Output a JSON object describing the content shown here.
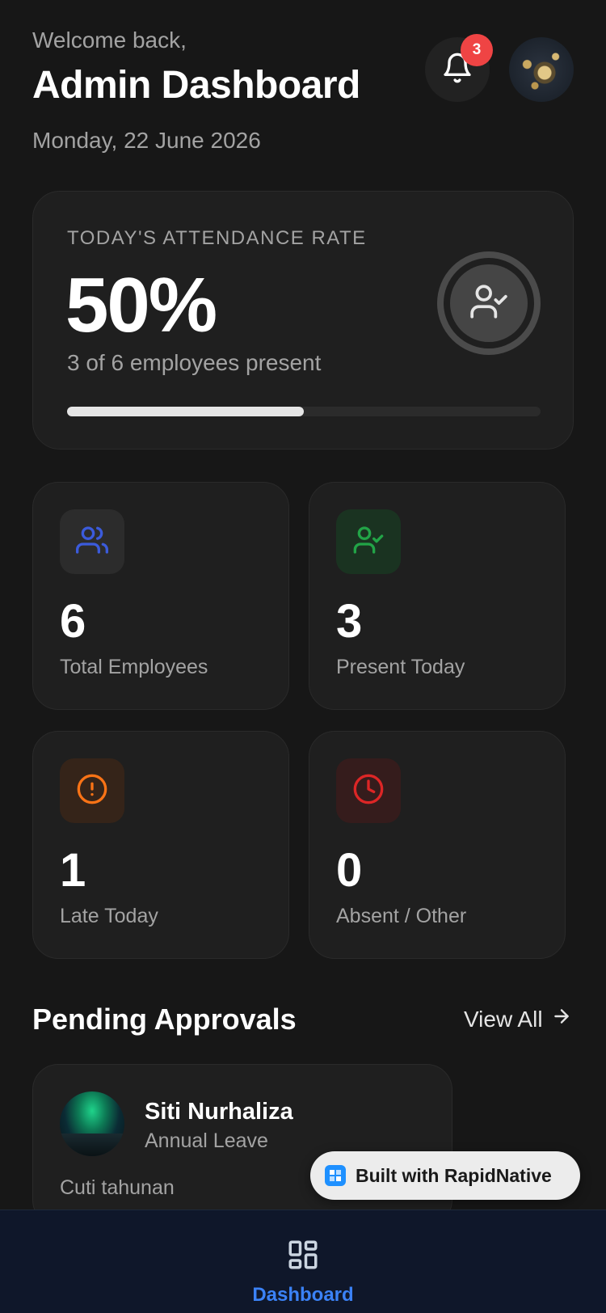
{
  "header": {
    "welcome": "Welcome back,",
    "title": "Admin Dashboard",
    "date": "Monday, 22 June 2026",
    "notification_count": "3"
  },
  "attendance": {
    "label": "TODAY'S ATTENDANCE RATE",
    "rate": "50%",
    "summary": "3 of 6 employees present",
    "progress": 0.5
  },
  "stats": [
    {
      "value": "6",
      "label": "Total Employees",
      "icon": "users-icon",
      "color": "#3b5bdb"
    },
    {
      "value": "3",
      "label": "Present Today",
      "icon": "user-check-icon",
      "color": "#22a447"
    },
    {
      "value": "1",
      "label": "Late Today",
      "icon": "alert-circle-icon",
      "color": "#f97316"
    },
    {
      "value": "0",
      "label": "Absent / Other",
      "icon": "clock-icon",
      "color": "#dc2626"
    }
  ],
  "pending": {
    "title": "Pending Approvals",
    "view_all": "View All",
    "items": [
      {
        "name": "Siti Nurhaliza",
        "type": "Annual Leave",
        "note": "Cuti tahunan"
      }
    ]
  },
  "built_with": "Built with RapidNative",
  "nav": {
    "items": [
      {
        "label": "Dashboard",
        "icon": "grid-icon",
        "active": true
      }
    ]
  },
  "colors": {
    "background": "#171717",
    "card": "#1f1f1f",
    "accent": "#3b82f6",
    "badge": "#ef4444"
  }
}
